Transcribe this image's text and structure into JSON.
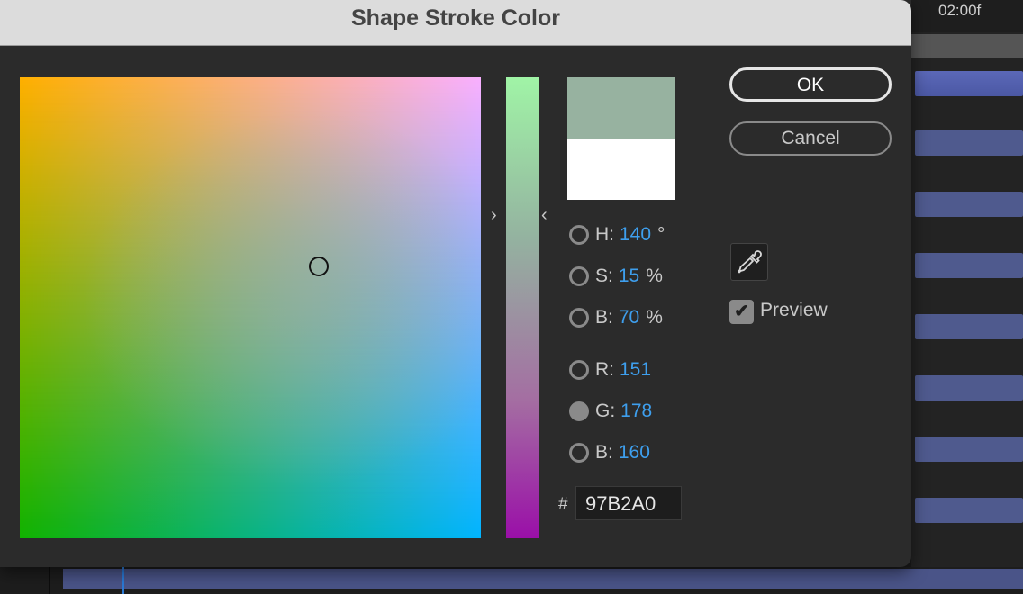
{
  "dialog": {
    "title": "Shape Stroke Color",
    "ok_label": "OK",
    "cancel_label": "Cancel",
    "new_color": "#97B2A0",
    "old_color": "#FFFFFF",
    "preview_label": "Preview",
    "preview_checked": true,
    "hex_symbol": "#",
    "hex_value": "97B2A0"
  },
  "fields": [
    {
      "label": "H:",
      "value": "140",
      "unit": "°",
      "selected": false
    },
    {
      "label": "S:",
      "value": "15",
      "unit": "%",
      "selected": false
    },
    {
      "label": "B:",
      "value": "70",
      "unit": "%",
      "selected": false
    },
    {
      "label": "R:",
      "value": "151",
      "unit": "",
      "selected": false
    },
    {
      "label": "G:",
      "value": "178",
      "unit": "",
      "selected": true
    },
    {
      "label": "B:",
      "value": "160",
      "unit": "",
      "selected": false
    }
  ],
  "timeline": {
    "time_label": "02:00f"
  },
  "icons": {
    "eyedropper": "eyedropper-icon",
    "checkmark": "✔"
  }
}
